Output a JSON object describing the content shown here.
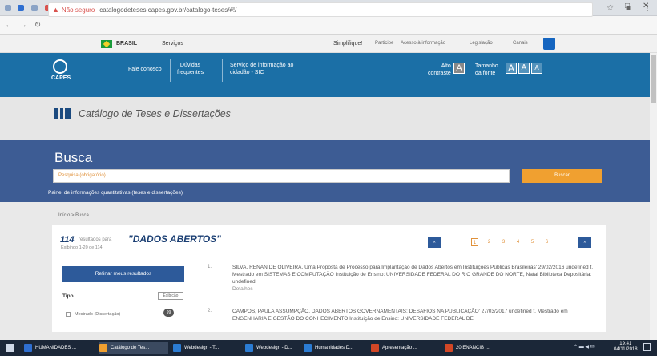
{
  "browser": {
    "tab_count": 40,
    "active_tab_index": 6,
    "window_controls": [
      "–",
      "□",
      "✕"
    ],
    "address": {
      "security_label": "Não seguro",
      "url": "catalogodeteses.capes.gov.br/catalogo-teses/#!/"
    }
  },
  "gov_bar": {
    "brasil": "BRASIL",
    "servicos": "Serviços",
    "links": [
      "Simplifique!",
      "Participe",
      "Acesso à informação",
      "Legislação",
      "Canais"
    ]
  },
  "header": {
    "logo_text": "CAPES",
    "links": [
      {
        "label_line1": "Fale conosco",
        "label_line2": ""
      },
      {
        "label_line1": "Dúvidas",
        "label_line2": "frequentes"
      },
      {
        "label_line1": "Serviço de informação ao",
        "label_line2": "cidadão - SIC"
      }
    ],
    "contrast_label_1": "Alto",
    "contrast_label_2": "contraste",
    "font_label_1": "Tamanho",
    "font_label_2": "da fonte",
    "font_buttons": [
      "A",
      "A",
      "A"
    ]
  },
  "catalog": {
    "title": "Catálogo de Teses e Dissertações"
  },
  "busca": {
    "title": "Busca",
    "placeholder": "Pesquisa (obrigatório)",
    "button_label": "Buscar",
    "panel_link": "Painel de informações quantitativas (teses e dissertações)"
  },
  "breadcrumb": "Início > Busca",
  "results": {
    "count": "114",
    "count_label": "resultados para",
    "query": "\"DADOS ABERTOS\"",
    "timing": "Exibindo 1-20 de 114",
    "pagination": {
      "first": "«",
      "last": "»",
      "pages": [
        "1",
        "2",
        "3",
        "4",
        "5",
        "6"
      ],
      "active_page": "1"
    },
    "refine_button": "Refinar meus resultados",
    "filter": {
      "label": "Tipo",
      "toggle": "Exibição",
      "option": "Mestrado (Dissertação)",
      "option_count": "99"
    },
    "items": [
      {
        "number": "1.",
        "text": "SILVA, RENAN DE OLIVEIRA. Uma Proposta de Processo para Implantação de Dados Abertos em Instituições Públicas Brasileiras' 29/02/2016 undefined f. Mestrado em SISTEMAS E COMPUTAÇÃO Instituição de Ensino: UNIVERSIDADE FEDERAL DO RIO GRANDE DO NORTE, Natal Biblioteca Depositária: undefined",
        "extra": "Detalhes"
      },
      {
        "number": "2.",
        "text": "CAMPOS, PAULA ASSUMPÇÃO. DADOS ABERTOS GOVERNAMENTAIS: DESAFIOS NA PUBLICAÇÃO' 27/03/2017 undefined f. Mestrado em ENGENHARIA E GESTÃO DO CONHECIMENTO Instituição de Ensino: UNIVERSIDADE FEDERAL DE",
        "extra": ""
      }
    ]
  },
  "taskbar": {
    "items": [
      {
        "label": "HUMANIDADES ...",
        "color": "#2f6fd1",
        "active": false
      },
      {
        "label": "Catálogo de Tes...",
        "color": "#f0a030",
        "active": true
      },
      {
        "label": "Webdesign - T...",
        "color": "#2b7cd3",
        "active": false
      },
      {
        "label": "Webdesign - D...",
        "color": "#2b7cd3",
        "active": false
      },
      {
        "label": "Humanidades D...",
        "color": "#2b7cd3",
        "active": false
      },
      {
        "label": "Apresentação ...",
        "color": "#d24726",
        "active": false
      },
      {
        "label": "20 ENANCIB ...",
        "color": "#d24726",
        "active": false
      }
    ],
    "time": "19:41",
    "date": "04/11/2018"
  }
}
